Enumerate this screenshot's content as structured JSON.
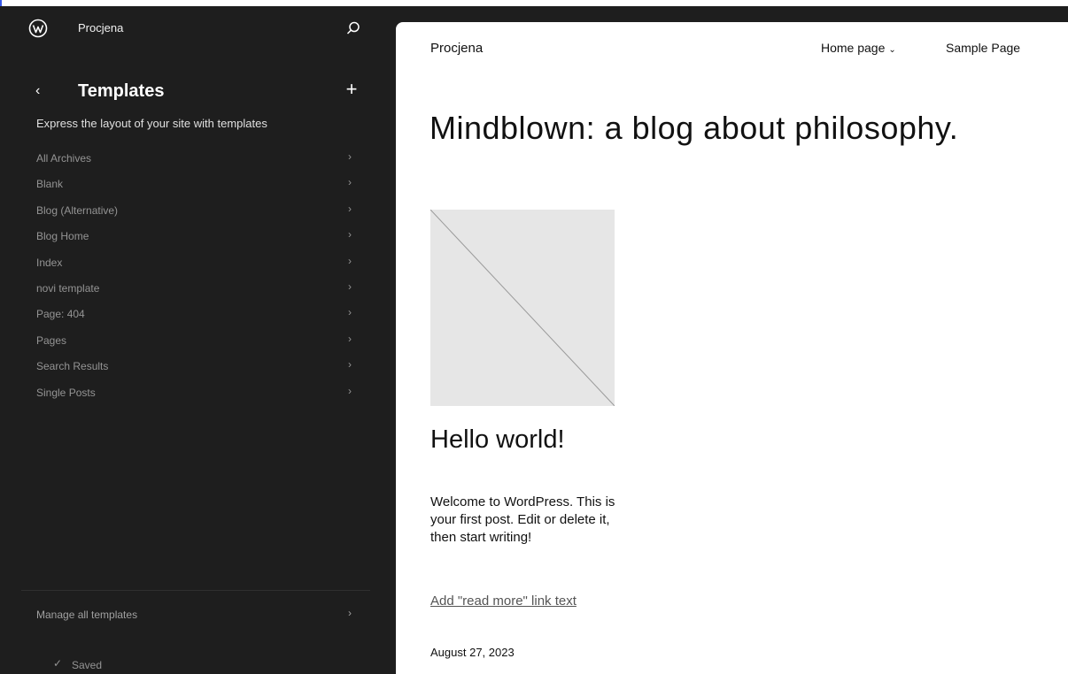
{
  "sidebar": {
    "site_name": "Procjena",
    "section_title": "Templates",
    "description": "Express the layout of your site with templates",
    "items": [
      {
        "label": "All Archives"
      },
      {
        "label": "Blank"
      },
      {
        "label": "Blog (Alternative)"
      },
      {
        "label": "Blog Home"
      },
      {
        "label": "Index"
      },
      {
        "label": "novi template"
      },
      {
        "label": "Page: 404"
      },
      {
        "label": "Pages"
      },
      {
        "label": "Search Results"
      },
      {
        "label": "Single Posts"
      }
    ],
    "manage_label": "Manage all templates",
    "saved_label": "Saved",
    "icons": {
      "logo": "wordpress-logo",
      "search": "search-icon",
      "back": "chevron-left-icon",
      "add": "plus-icon",
      "item": "chevron-right-icon",
      "saved": "check-icon"
    }
  },
  "preview": {
    "site_title": "Procjena",
    "nav": [
      {
        "label": "Home page",
        "has_dropdown": true
      },
      {
        "label": "Sample Page",
        "has_dropdown": false
      }
    ],
    "heading": "Mindblown: a blog about philosophy.",
    "post": {
      "title": "Hello world!",
      "excerpt": "Welcome to WordPress. This is your first post. Edit or delete it, then start writing!",
      "read_more": "Add \"read more\" link text",
      "date": "August 27, 2023"
    }
  },
  "colors": {
    "sidebar_bg": "#1e1e1e",
    "accent": "#3858e9",
    "muted_text": "#949494",
    "canvas_bg": "#ffffff"
  }
}
